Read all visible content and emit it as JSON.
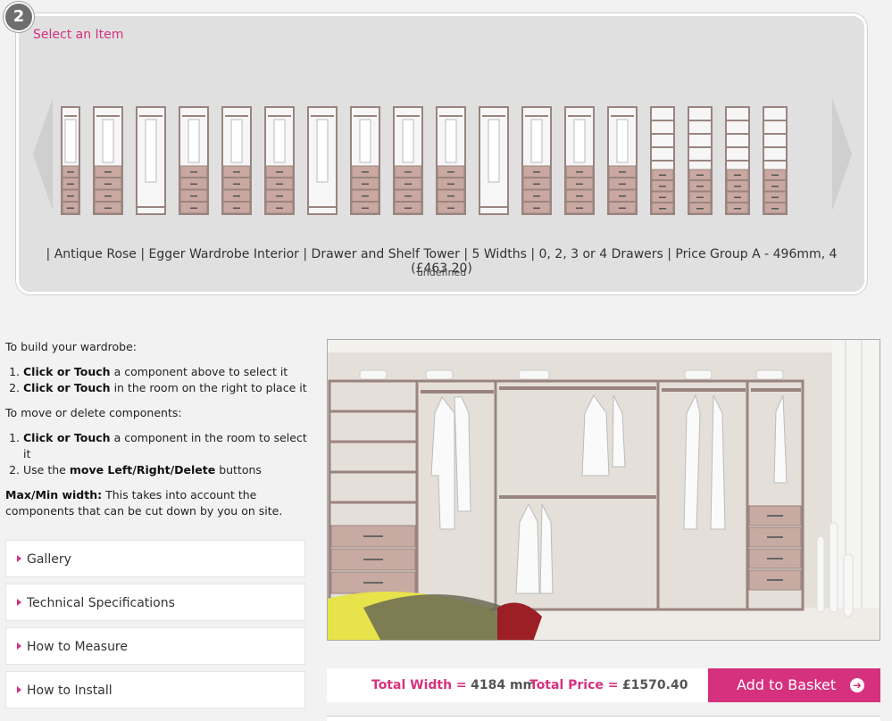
{
  "step": {
    "number": "2"
  },
  "selector": {
    "title": "Select an Item",
    "description": "| Antique Rose | Egger Wardrobe Interior | Drawer and Shelf Tower | 5 Widths | 0, 2, 3 or 4 Drawers | Price Group A - 496mm, 4 (£463.20)",
    "subtext": "undefined",
    "items": [
      {
        "kind": "hang-drawers"
      },
      {
        "kind": "hang-drawers"
      },
      {
        "kind": "long-hang"
      },
      {
        "kind": "hang-drawers"
      },
      {
        "kind": "hang-drawers"
      },
      {
        "kind": "hang-drawers"
      },
      {
        "kind": "long-hang"
      },
      {
        "kind": "hang-drawers"
      },
      {
        "kind": "hang-drawers"
      },
      {
        "kind": "hang-drawers"
      },
      {
        "kind": "long-hang"
      },
      {
        "kind": "hang-drawers"
      },
      {
        "kind": "hang-drawers"
      },
      {
        "kind": "hang-drawers"
      },
      {
        "kind": "shelves-drawers"
      },
      {
        "kind": "shelves-drawers"
      },
      {
        "kind": "shelves-drawers"
      },
      {
        "kind": "shelves-drawers"
      }
    ]
  },
  "instructions": {
    "build_heading": "To build your wardrobe:",
    "build_steps": [
      {
        "bold": "Click or Touch",
        "rest": " a component above to select it"
      },
      {
        "bold": "Click or Touch",
        "rest": " in the room on the right to place it"
      }
    ],
    "move_heading": "To move or delete components:",
    "move_steps": [
      {
        "bold": "Click or Touch",
        "rest": " a component in the room to select it"
      },
      {
        "pre": "Use the ",
        "bold": "move Left/Right/Delete",
        "rest": " buttons"
      }
    ],
    "maxmin_bold": "Max/Min width:",
    "maxmin_rest": " This takes into account the components that can be cut down by you on site."
  },
  "accordion": [
    {
      "label": "Gallery"
    },
    {
      "label": "Technical Specifications"
    },
    {
      "label": "How to Measure"
    },
    {
      "label": "How to Install"
    }
  ],
  "summary": {
    "width_label": "Total Width =",
    "width_value": "4184 mm",
    "price_label": "Total Price =",
    "price_value": "£1570.40"
  },
  "basket": {
    "label": "Add to Basket",
    "icon": "arrow-circle-right-icon"
  },
  "colors": {
    "accent": "#d6317e",
    "panel": "#e0e0e0",
    "frame": "#9a8480",
    "drawer": "#c8a8a0"
  }
}
